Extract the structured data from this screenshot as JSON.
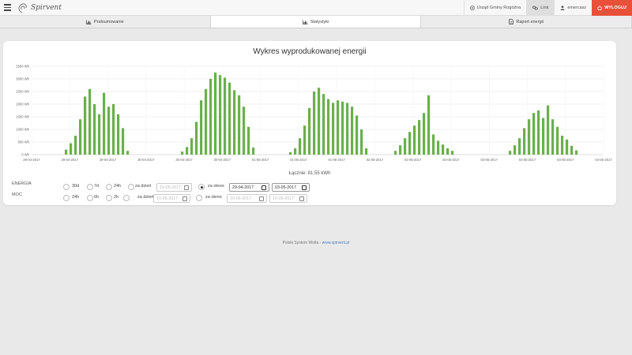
{
  "brand": {
    "name": "Spirvent"
  },
  "topbar": {
    "location": "Urząd Gminy Rogóźna",
    "link": "Link",
    "user": "emercasz",
    "logout": "WYLOGUJ"
  },
  "tabs": [
    {
      "label": "Podsumowanie",
      "icon": "bar-chart-icon",
      "active": false
    },
    {
      "label": "Statystyki",
      "icon": "bar-chart-icon",
      "active": true
    },
    {
      "label": "Raport energii",
      "icon": "document-icon",
      "active": false
    }
  ],
  "chart_data": {
    "type": "bar",
    "title": "Wykres wyprodukowanej energii",
    "ylabel": "",
    "xlabel": "",
    "ylim": [
      0,
      3500
    ],
    "y_ticks": [
      "0 Wh",
      "500 Wh",
      "1000 Wh",
      "1500 Wh",
      "2000 Wh",
      "2500 Wh",
      "3000 Wh",
      "3500 Wh"
    ],
    "x_ticks": [
      "29-04-2017",
      "29-04-2017",
      "29-04-2017",
      "30-04-2017",
      "30-04-2017",
      "30-04-2017",
      "01-05-2017",
      "01-05-2017",
      "01-05-2017",
      "02-05-2017",
      "02-05-2017",
      "02-05-2017",
      "03-05-2017",
      "03-05-2017",
      "03-05-2017",
      "04-05-2017"
    ],
    "bar_color": "#6ab04c",
    "grid": true,
    "days": [
      {
        "date": "29-04-2017",
        "values": [
          200,
          450,
          750,
          1400,
          2300,
          2600,
          2000,
          1600,
          2450,
          1900,
          2000,
          1600,
          1050,
          150
        ]
      },
      {
        "date": "30-04-2017",
        "values": [
          120,
          300,
          650,
          1300,
          2150,
          2600,
          3000,
          3250,
          3150,
          3050,
          2850,
          2550,
          2350,
          1900,
          1100,
          280
        ]
      },
      {
        "date": "01-05-2017",
        "values": [
          100,
          250,
          650,
          1150,
          1850,
          2500,
          2650,
          2400,
          2200,
          2050,
          2150,
          2100,
          2050,
          1900,
          1550,
          1000,
          250
        ]
      },
      {
        "date": "02-05-2017",
        "values": [
          150,
          370,
          650,
          900,
          1150,
          1370,
          1650,
          2350,
          800,
          550,
          400,
          250,
          150
        ]
      },
      {
        "date": "03-05-2017",
        "values": [
          150,
          370,
          650,
          1050,
          1400,
          1650,
          1750,
          1450,
          1950,
          1400,
          1100,
          750,
          600,
          350,
          170
        ]
      }
    ]
  },
  "total": "Łącznie: 81.55 kWh",
  "filters": {
    "energia": {
      "label": "ENERGIA",
      "options": [
        "30d",
        "7d",
        "24h"
      ],
      "za_dzien_label": "za dzień",
      "za_dzien_date": "10-05-2017",
      "za_okres_label": "za okres",
      "from": "29-04-2017",
      "to": "03-05-2017",
      "selected": "za okres"
    },
    "moc": {
      "label": "MOC",
      "options": [
        "24h",
        "6h",
        "2h"
      ],
      "za_dzien_label": "za dzień",
      "za_dzien_date": "10-05-2017",
      "za_okres_label": "za okres",
      "from": "10-05-2017",
      "to": "10-05-2017"
    }
  },
  "footer": {
    "text": "Polski System Wolta - ",
    "link": "www.spirvent.pl"
  }
}
